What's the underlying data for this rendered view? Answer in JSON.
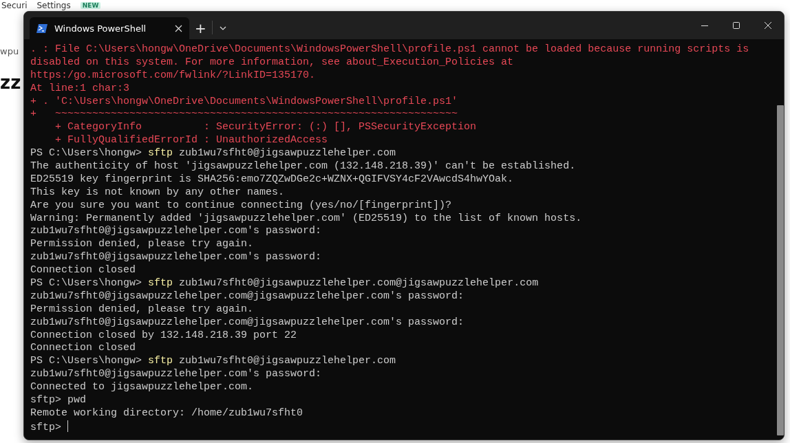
{
  "background_page": {
    "top_links": [
      {
        "label": "Securi"
      },
      {
        "label": "Settings",
        "badge": "NEW"
      }
    ],
    "side_texts": [
      {
        "text": "wpu",
        "kind": "small"
      },
      {
        "text": "zz",
        "kind": "heading"
      }
    ]
  },
  "window": {
    "tabs": [
      {
        "title": "Windows PowerShell",
        "selected": true
      }
    ],
    "new_tab": "+"
  },
  "terminal": {
    "lines": [
      {
        "kind": "error",
        "text": ". : File C:\\Users\\hongw\\OneDrive\\Documents\\WindowsPowerShell\\profile.ps1 cannot be loaded because running scripts is"
      },
      {
        "kind": "error",
        "text": "disabled on this system. For more information, see about_Execution_Policies at"
      },
      {
        "kind": "error",
        "text": "https:/go.microsoft.com/fwlink/?LinkID=135170."
      },
      {
        "kind": "error",
        "text": "At line:1 char:3"
      },
      {
        "kind": "error",
        "text": "+ . 'C:\\Users\\hongw\\OneDrive\\Documents\\WindowsPowerShell\\profile.ps1'"
      },
      {
        "kind": "error",
        "text": "+   ~~~~~~~~~~~~~~~~~~~~~~~~~~~~~~~~~~~~~~~~~~~~~~~~~~~~~~~~~~~~~~~~~"
      },
      {
        "kind": "error",
        "text": "    + CategoryInfo          : SecurityError: (:) [], PSSecurityException"
      },
      {
        "kind": "error",
        "text": "    + FullyQualifiedErrorId : UnauthorizedAccess"
      },
      {
        "kind": "prompt",
        "prompt": "PS C:\\Users\\hongw>",
        "command": "sftp",
        "args": "zub1wu7sfht0@jigsawpuzzlehelper.com"
      },
      {
        "kind": "output",
        "text": "The authenticity of host 'jigsawpuzzlehelper.com (132.148.218.39)' can't be established."
      },
      {
        "kind": "output",
        "text": "ED25519 key fingerprint is SHA256:emo7ZQZwDGe2c+WZNX+QGIFVSY4cF2VAwcdS4hwYOak."
      },
      {
        "kind": "output",
        "text": "This key is not known by any other names."
      },
      {
        "kind": "output",
        "text": "Are you sure you want to continue connecting (yes/no/[fingerprint])?"
      },
      {
        "kind": "output",
        "text": "Warning: Permanently added 'jigsawpuzzlehelper.com' (ED25519) to the list of known hosts."
      },
      {
        "kind": "output",
        "text": "zub1wu7sfht0@jigsawpuzzlehelper.com's password:"
      },
      {
        "kind": "output",
        "text": "Permission denied, please try again."
      },
      {
        "kind": "output",
        "text": "zub1wu7sfht0@jigsawpuzzlehelper.com's password:"
      },
      {
        "kind": "output",
        "text": "Connection closed"
      },
      {
        "kind": "prompt",
        "prompt": "PS C:\\Users\\hongw>",
        "command": "sftp",
        "args": "zub1wu7sfht0@jigsawpuzzlehelper.com@jigsawpuzzlehelper.com"
      },
      {
        "kind": "output",
        "text": "zub1wu7sfht0@jigsawpuzzlehelper.com@jigsawpuzzlehelper.com's password:"
      },
      {
        "kind": "output",
        "text": "Permission denied, please try again."
      },
      {
        "kind": "output",
        "text": "zub1wu7sfht0@jigsawpuzzlehelper.com@jigsawpuzzlehelper.com's password:"
      },
      {
        "kind": "output",
        "text": "Connection closed by 132.148.218.39 port 22"
      },
      {
        "kind": "output",
        "text": "Connection closed"
      },
      {
        "kind": "prompt",
        "prompt": "PS C:\\Users\\hongw>",
        "command": "sftp",
        "args": "zub1wu7sfht0@jigsawpuzzlehelper.com"
      },
      {
        "kind": "output",
        "text": "zub1wu7sfht0@jigsawpuzzlehelper.com's password:"
      },
      {
        "kind": "output",
        "text": "Connected to jigsawpuzzlehelper.com."
      },
      {
        "kind": "output",
        "text": "sftp> pwd"
      },
      {
        "kind": "output",
        "text": "Remote working directory: /home/zub1wu7sfht0"
      },
      {
        "kind": "cursor",
        "text": "sftp>"
      }
    ]
  }
}
